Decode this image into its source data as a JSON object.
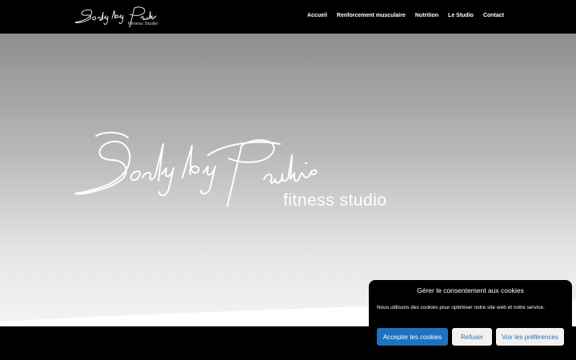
{
  "header": {
    "logo_script": "Body by Pauline",
    "logo_tagline": "Fitness Studio",
    "nav": [
      {
        "label": "Accueil"
      },
      {
        "label": "Renforcement musculaire"
      },
      {
        "label": "Nutrition"
      },
      {
        "label": "Le Studio"
      },
      {
        "label": "Contact"
      }
    ]
  },
  "hero": {
    "logo_script": "Body by Pauline",
    "subtitle": "fitness studio"
  },
  "cookie_banner": {
    "title": "Gérer le consentement aux cookies",
    "text": "Nous utilisons des cookies pour optimiser notre site web et notre service.",
    "accept_label": "Accepter les cookies",
    "refuse_label": "Refuser",
    "prefs_label": "Voir les préférences"
  },
  "colors": {
    "header_bg": "#000000",
    "accent": "#1e73be",
    "hero_gradient_top": "#8e8e8e",
    "hero_gradient_bottom": "#f4f4f4"
  }
}
